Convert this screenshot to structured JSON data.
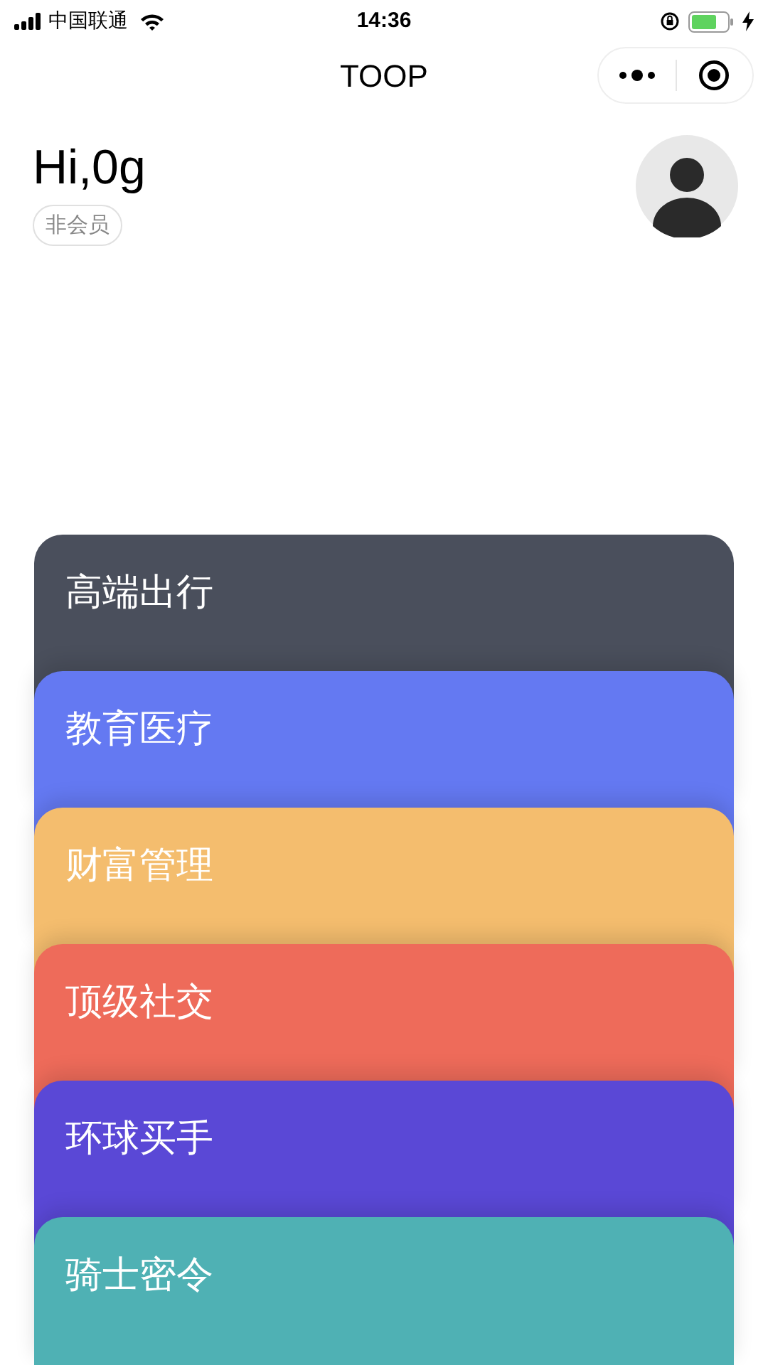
{
  "status_bar": {
    "carrier": "中国联通",
    "time": "14:36"
  },
  "nav": {
    "title": "TOOP"
  },
  "profile": {
    "greeting": "Hi,0g",
    "badge": "非会员"
  },
  "cards": [
    {
      "label": "高端出行",
      "color": "#4a4f5c"
    },
    {
      "label": "教育医疗",
      "color": "#6479f2"
    },
    {
      "label": "财富管理",
      "color": "#f4bd6e"
    },
    {
      "label": "顶级社交",
      "color": "#ee6b5a"
    },
    {
      "label": "环球买手",
      "color": "#5a48d6"
    },
    {
      "label": "骑士密令",
      "color": "#4fb1b4"
    }
  ]
}
